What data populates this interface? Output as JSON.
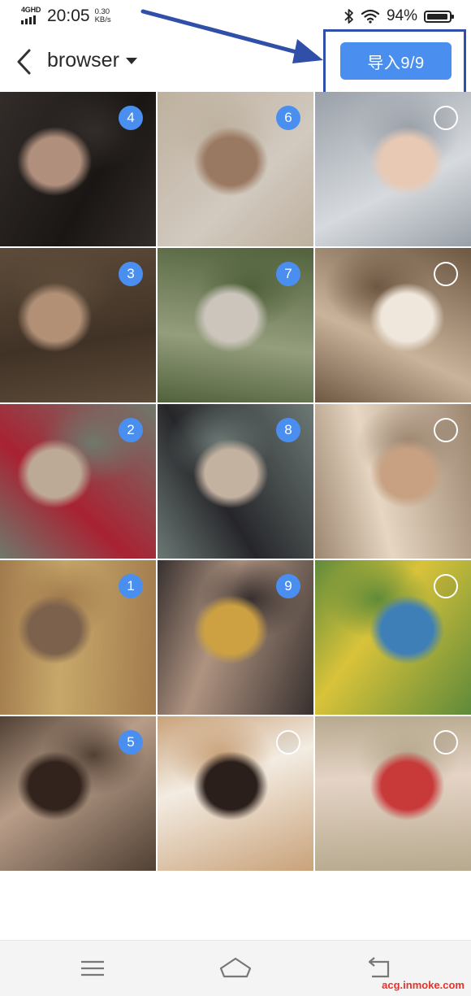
{
  "status_bar": {
    "network": "4GHD",
    "time": "20:05",
    "speed_value": "0.30",
    "speed_unit": "KB/s",
    "battery": "94%",
    "battery_level": 0.94
  },
  "header": {
    "album_name": "browser",
    "import_button": "导入9/9"
  },
  "colors": {
    "accent": "#4a8ff0",
    "annotation": "#2f4fa8",
    "watermark": "#e8322a"
  },
  "photos": [
    {
      "selected": true,
      "order": "4",
      "palette": [
        "#3a3330",
        "#1e1a18",
        "#c9a48f"
      ]
    },
    {
      "selected": true,
      "order": "6",
      "palette": [
        "#d8c9b4",
        "#efe6da",
        "#b08a70"
      ]
    },
    {
      "selected": false,
      "order": "",
      "palette": [
        "#9aa0a8",
        "#d6dade",
        "#e8c9b4"
      ]
    },
    {
      "selected": true,
      "order": "3",
      "palette": [
        "#6b5642",
        "#4a3a2c",
        "#caa487"
      ]
    },
    {
      "selected": true,
      "order": "7",
      "palette": [
        "#5d7044",
        "#a9b38e",
        "#e7e1d6"
      ]
    },
    {
      "selected": false,
      "order": "",
      "palette": [
        "#6f5843",
        "#c9b39a",
        "#efe7dc"
      ]
    },
    {
      "selected": true,
      "order": "2",
      "palette": [
        "#7f8a7c",
        "#c1273a",
        "#d7c1ab"
      ]
    },
    {
      "selected": true,
      "order": "8",
      "palette": [
        "#7c8a86",
        "#2c2c30",
        "#e0cbb7"
      ]
    },
    {
      "selected": false,
      "order": "",
      "palette": [
        "#9c8670",
        "#e6d6c2",
        "#c7a182"
      ]
    },
    {
      "selected": true,
      "order": "1",
      "palette": [
        "#b88c58",
        "#e4c079",
        "#8e6f57"
      ]
    },
    {
      "selected": true,
      "order": "9",
      "palette": [
        "#3f3735",
        "#c8a893",
        "#eab84a"
      ]
    },
    {
      "selected": false,
      "order": "",
      "palette": [
        "#5f8a3a",
        "#d9c33a",
        "#3e7fb8"
      ]
    },
    {
      "selected": true,
      "order": "5",
      "palette": [
        "#5c4a3c",
        "#d2b39c",
        "#3a2a22"
      ]
    },
    {
      "selected": false,
      "order": "",
      "palette": [
        "#c9a27a",
        "#f3ece2",
        "#2b1f1b"
      ]
    },
    {
      "selected": false,
      "order": "",
      "palette": [
        "#b7a98e",
        "#e5d4c6",
        "#c83a3a"
      ]
    }
  ],
  "nav": {
    "menu_icon": "menu-icon",
    "home_icon": "home-icon",
    "back_icon": "return-icon"
  },
  "watermark": "acg.inmoke.com"
}
